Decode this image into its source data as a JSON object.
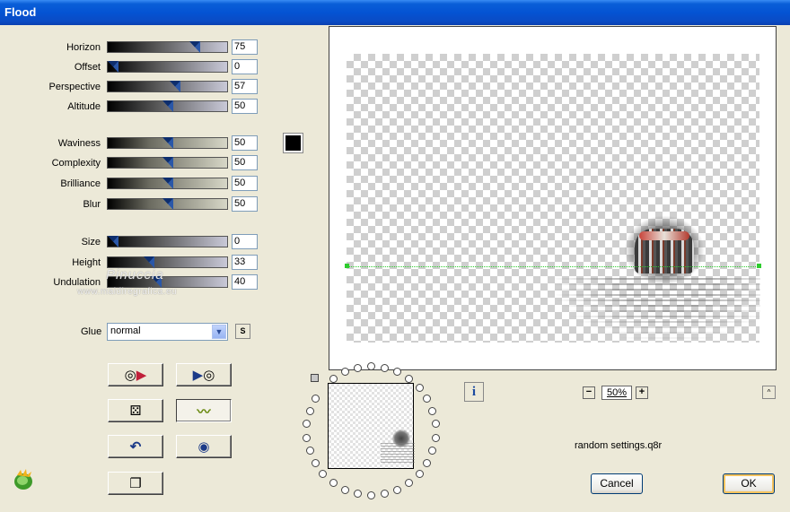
{
  "window": {
    "title": "Flood"
  },
  "sliders": [
    {
      "id": "horizon",
      "label": "Horizon",
      "value": "75",
      "percent": 75,
      "style": "gray"
    },
    {
      "id": "offset",
      "label": "Offset",
      "value": "0",
      "percent": 0,
      "style": "gray"
    },
    {
      "id": "perspective",
      "label": "Perspective",
      "value": "57",
      "percent": 57,
      "style": "gray"
    },
    {
      "id": "altitude",
      "label": "Altitude",
      "value": "50",
      "percent": 50,
      "style": "gray"
    },
    {
      "id": "waviness",
      "label": "Waviness",
      "value": "50",
      "percent": 50,
      "style": "beige"
    },
    {
      "id": "complexity",
      "label": "Complexity",
      "value": "50",
      "percent": 50,
      "style": "beige"
    },
    {
      "id": "brilliance",
      "label": "Brilliance",
      "value": "50",
      "percent": 50,
      "style": "beige"
    },
    {
      "id": "blur",
      "label": "Blur",
      "value": "50",
      "percent": 50,
      "style": "beige"
    },
    {
      "id": "size",
      "label": "Size",
      "value": "0",
      "percent": 0,
      "style": "gray"
    },
    {
      "id": "height",
      "label": "Height",
      "value": "33",
      "percent": 33,
      "style": "gray"
    },
    {
      "id": "undulation",
      "label": "Undulation",
      "value": "40",
      "percent": 40,
      "style": "gray"
    }
  ],
  "color_swatch": {
    "color": "#000000"
  },
  "glue": {
    "label": "Glue",
    "value": "normal",
    "s_label": "S"
  },
  "watermark": {
    "name": "Pinuccia",
    "url": "www.maidiregrafica.eu"
  },
  "toolbar_icons": [
    "reset-next-icon",
    "next-reset-icon",
    "dice-icon",
    "wave-icon",
    "undo-icon",
    "circle-icon",
    "copy-icon"
  ],
  "info_label": "i",
  "zoom": {
    "minus": "−",
    "value": "50%",
    "plus": "+"
  },
  "up_label": "^",
  "preset": "random settings.q8r",
  "buttons": {
    "cancel": "Cancel",
    "ok": "OK"
  }
}
